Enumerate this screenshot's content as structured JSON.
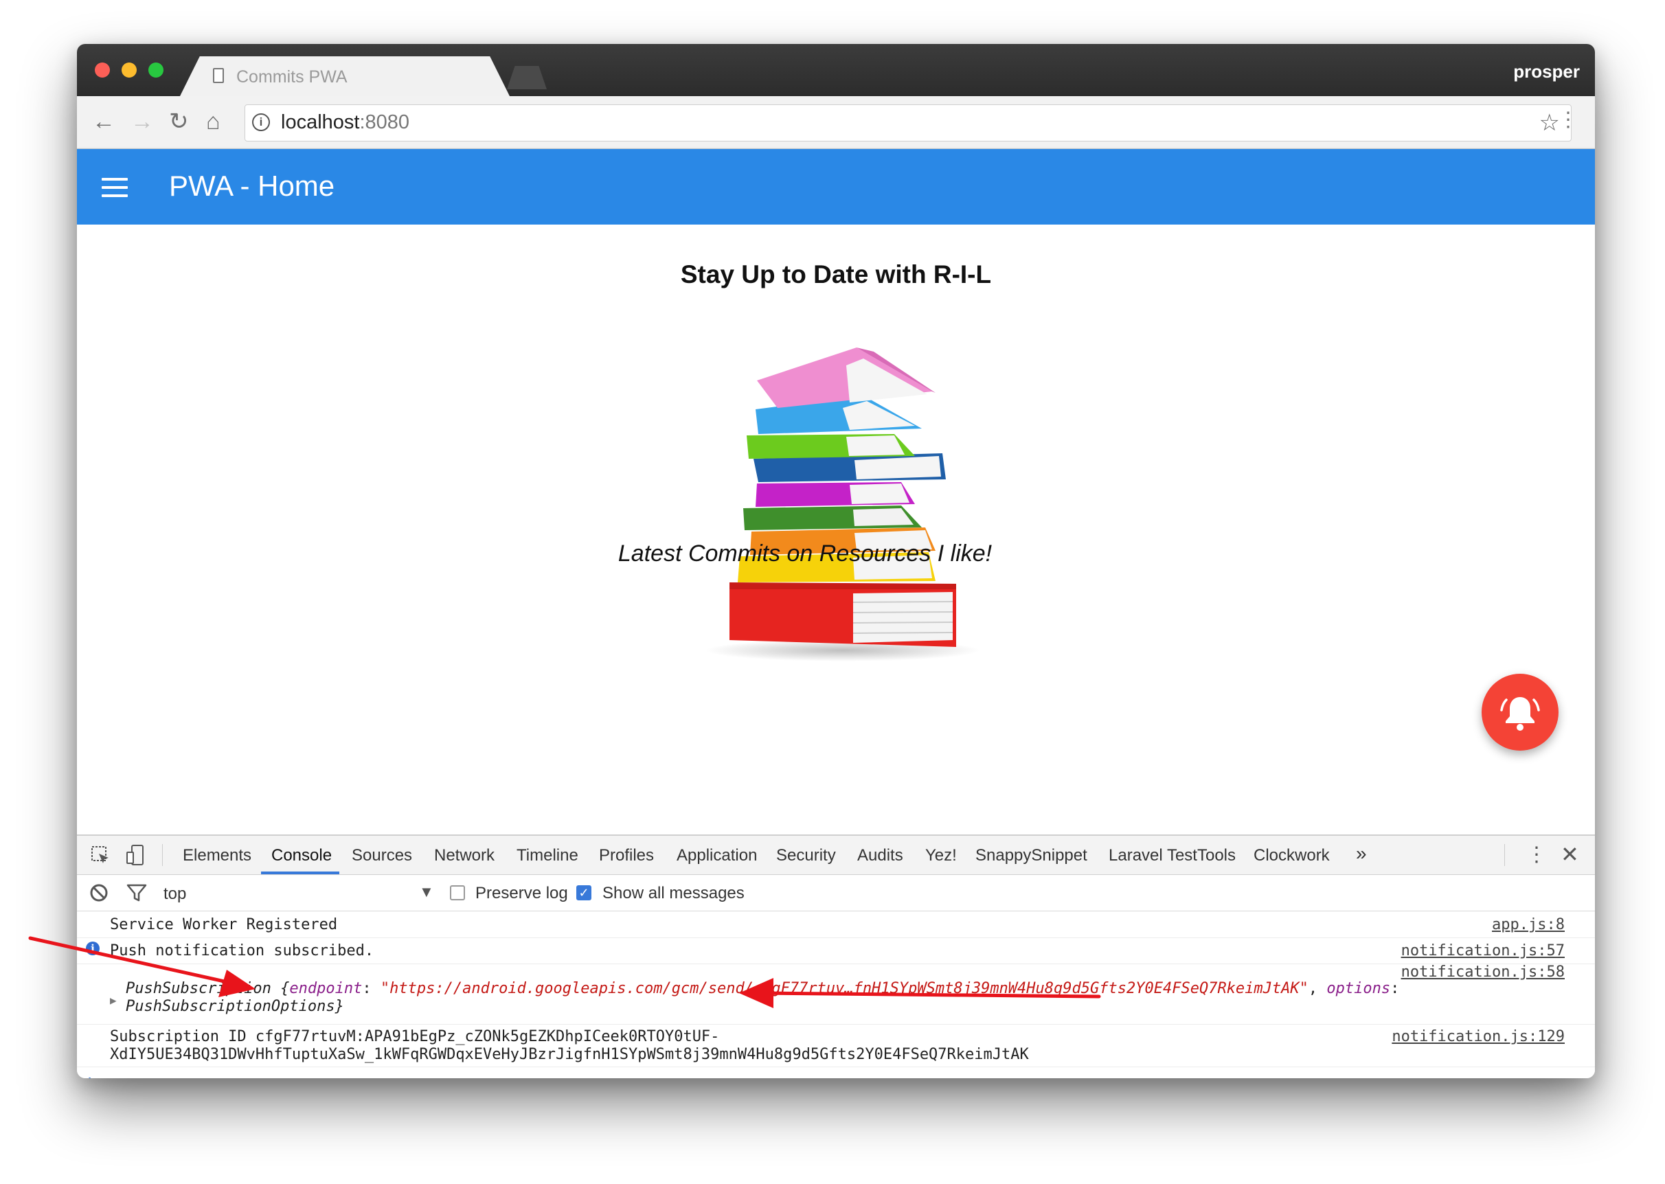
{
  "browser": {
    "tab_title": "Commits PWA",
    "tab_close": "×",
    "profile_name": "prosper",
    "url_host": "localhost",
    "url_port": ":8080"
  },
  "app": {
    "title": "PWA - Home",
    "headline": "Stay Up to Date with R-I-L",
    "subtitle": "Latest Commits on Resources I like!"
  },
  "devtools": {
    "tabs": [
      "Elements",
      "Console",
      "Sources",
      "Network",
      "Timeline",
      "Profiles",
      "Application",
      "Security",
      "Audits",
      "Yez!",
      "SnappySnippet",
      "Laravel TestTools",
      "Clockwork"
    ],
    "active_tab": "Console",
    "more_tabs": "»",
    "context": "top",
    "preserve_log_label": "Preserve log",
    "preserve_log_checked": false,
    "show_all_label": "Show all messages",
    "show_all_checked": true,
    "console": [
      {
        "text": "Service Worker Registered",
        "source": "app.js:8"
      },
      {
        "text": "Push notification subscribed.",
        "source": "notification.js:57",
        "level": "info"
      },
      {
        "object_name": "PushSubscription",
        "open_brace": " {",
        "key1": "endpoint",
        "colon1": ": ",
        "value1": "\"https://android.googleapis.com/gcm/send/cfgF77rtuv…fnH1SYpWSmt8j39mnW4Hu8g9d5Gfts2Y0E4FSeQ7RkeimJtAK\"",
        "comma": ", ",
        "key2": "options",
        "colon2": ":",
        "value2": "PushSubscriptionOptions}",
        "source": "notification.js:58"
      },
      {
        "line1": "Subscription ID cfgF77rtuvM:APA91bEgPz_cZONk5gEZKDhpICeek0RTOY0tUF-",
        "line2": "XdIY5UE34BQ31DWvHhfTuptuXaSw_1kWFqRGWDqxEVeHyJBzrJigfnH1SYpWSmt8j39mnW4Hu8g9d5Gfts2Y0E4FSeQ7RkeimJtAK",
        "source": "notification.js:129"
      }
    ],
    "prompt": "›"
  },
  "colors": {
    "app_bar": "#2a88e6",
    "fab": "#f44336",
    "annotation_arrow": "#e8141b"
  }
}
